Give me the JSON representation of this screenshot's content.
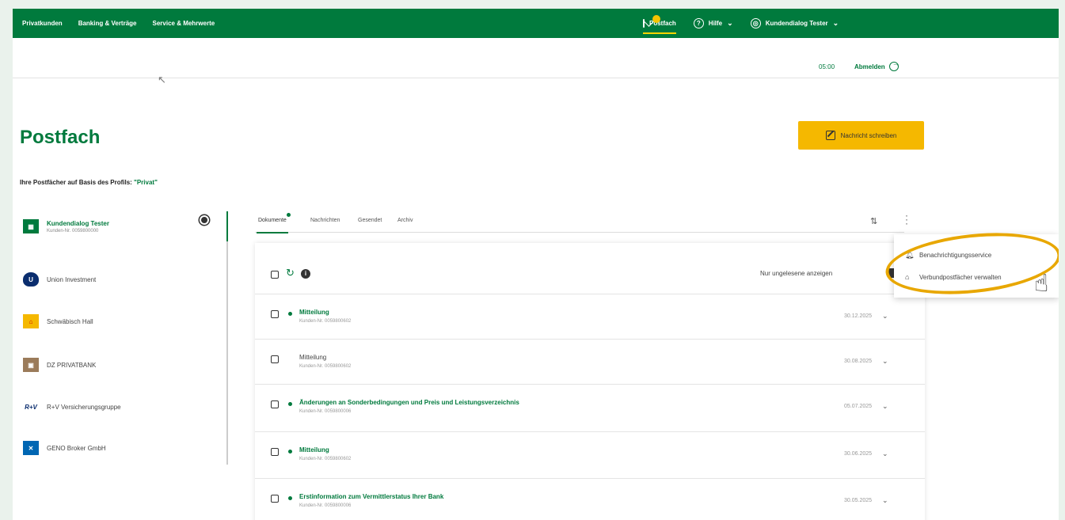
{
  "topbar": {
    "nav": [
      "Privatkunden",
      "Banking & Verträge",
      "Service & Mehrwerte"
    ],
    "postfach_label": "Postfach",
    "help_label": "Hilfe",
    "user_label": "Kundendialog Tester"
  },
  "subbar": {
    "timer": "05:00",
    "logout_label": "Abmelden"
  },
  "page": {
    "title": "Postfach",
    "compose_label": "Nachricht schreiben",
    "profile_prefix": "Ihre Postfächer auf Basis des Profils: ",
    "profile_value": "\"Privat\""
  },
  "sidebar": {
    "items": [
      {
        "label": "Kundendialog Tester",
        "sub": "Kunden-Nr. 0059800000",
        "logo_color": "#007a3d"
      },
      {
        "label": "Union Investment",
        "logo_color": "#0a2d6e"
      },
      {
        "label": "Schwäbisch Hall",
        "logo_color": "#f5b800"
      },
      {
        "label": "DZ PRIVATBANK",
        "logo_color": "#9b7b5a"
      },
      {
        "label": "R+V Versicherungsgruppe",
        "logo_color": "#0a2d6e"
      },
      {
        "label": "GENO Broker GmbH",
        "logo_color": "#0066b3"
      }
    ]
  },
  "tabs": [
    "Dokumente",
    "Nachrichten",
    "Gesendet",
    "Archiv"
  ],
  "list": {
    "unread_label": "Nur ungelesene anzeigen",
    "rows": [
      {
        "subject": "Mitteilung",
        "customer": "Kunden-Nr. 0059800602",
        "date": "30.12.2025",
        "unread": true
      },
      {
        "subject": "Mitteilung",
        "customer": "Kunden-Nr. 0059800602",
        "date": "30.08.2025",
        "unread": false
      },
      {
        "subject": "Änderungen an Sonderbedingungen und Preis und Leistungsverzeichnis",
        "customer": "Kunden-Nr. 0059800006",
        "date": "05.07.2025",
        "unread": true
      },
      {
        "subject": "Mitteilung",
        "customer": "Kunden-Nr. 0059800602",
        "date": "30.06.2025",
        "unread": true
      },
      {
        "subject": "Erstinformation zum Vermittlerstatus Ihrer Bank",
        "customer": "Kunden-Nr. 0059800006",
        "date": "30.05.2025",
        "unread": true
      }
    ]
  },
  "dropdown": {
    "items": [
      "Benachrichtigungsservice",
      "Verbundpostfächer verwalten"
    ]
  },
  "colors": {
    "brand": "#007a3d",
    "accent": "#f5b800",
    "highlight": "#e8a700"
  }
}
